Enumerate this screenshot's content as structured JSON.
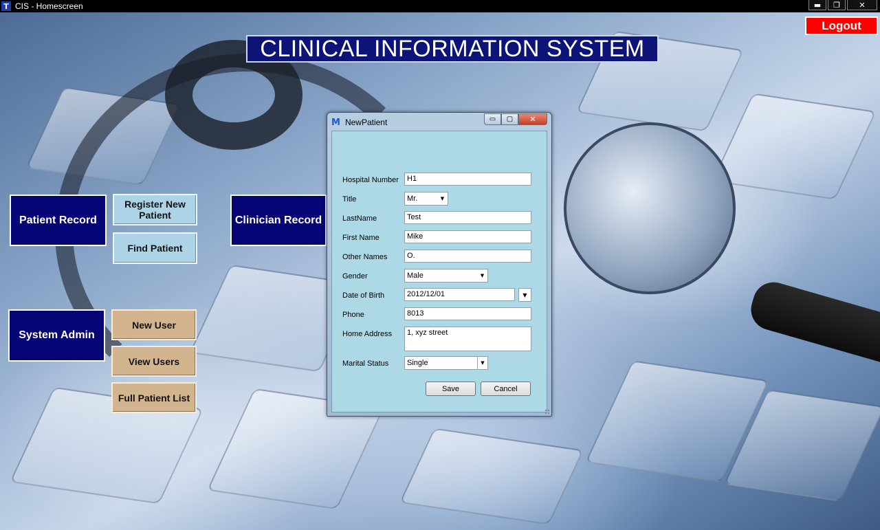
{
  "window": {
    "icon": "T",
    "title": "CIS - Homescreen",
    "controls": {
      "minimize": "▬",
      "maximize": "❐",
      "close": "✕"
    }
  },
  "header": {
    "title": "CLINICAL INFORMATION SYSTEM",
    "logout_label": "Logout"
  },
  "tiles": {
    "patient_record": "Patient Record",
    "register_new_patient": "Register New Patient",
    "find_patient": "Find Patient",
    "clinician_record": "Clinician Record",
    "system_admin": "System Admin",
    "new_user": "New User",
    "view_users": "View Users",
    "full_patient_list": "Full Patient List"
  },
  "dialog": {
    "icon": "M",
    "title": "NewPatient",
    "controls": {
      "minimize": "▭",
      "maximize": "▢",
      "close": "✕"
    },
    "fields": {
      "hospital_number": {
        "label": "Hospital Number",
        "value": "H1"
      },
      "title": {
        "label": "Title",
        "value": "Mr."
      },
      "last_name": {
        "label": "LastName",
        "value": "Test"
      },
      "first_name": {
        "label": "First Name",
        "value": "Mike"
      },
      "other_names": {
        "label": "Other Names",
        "value": "O."
      },
      "gender": {
        "label": "Gender",
        "value": "Male"
      },
      "date_of_birth": {
        "label": "Date of Birth",
        "value": "2012/12/01"
      },
      "phone": {
        "label": "Phone",
        "value": "8013"
      },
      "home_address": {
        "label": "Home Address",
        "value": "1, xyz street"
      },
      "marital_status": {
        "label": "Marital Status",
        "value": "Single"
      }
    },
    "save_label": "Save",
    "cancel_label": "Cancel",
    "dropdown_arrow": "▼"
  },
  "colors": {
    "headline_bg": "#0c1478",
    "dark_tile": "#060575",
    "light_tile": "#acd3e6",
    "tan_tile": "#d2b48e",
    "logout": "#ff0000",
    "dialog_body": "#add8e6"
  }
}
